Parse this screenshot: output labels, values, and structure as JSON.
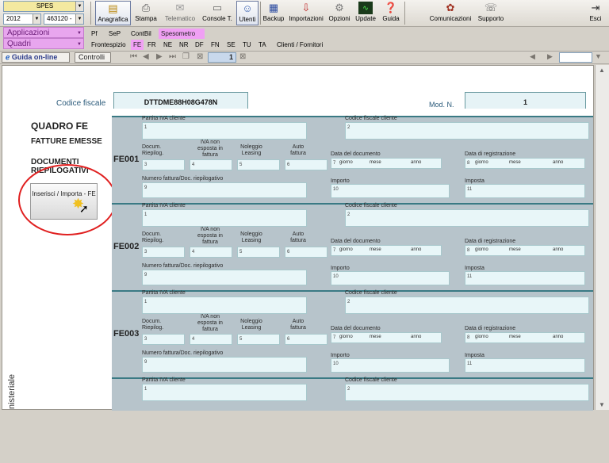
{
  "toolbar": {
    "top_select": "SPES",
    "year": "2012",
    "code": "463120 -",
    "buttons": [
      {
        "label": "Anagrafica",
        "icon": "address-book-icon"
      },
      {
        "label": "Stampa",
        "icon": "printer-icon"
      },
      {
        "label": "Telematico",
        "icon": "telematic-icon"
      },
      {
        "label": "Console T.",
        "icon": "console-icon"
      },
      {
        "label": "Utenti",
        "icon": "users-icon"
      },
      {
        "label": "Backup",
        "icon": "backup-icon"
      },
      {
        "label": "Importazioni",
        "icon": "import-icon"
      },
      {
        "label": "Opzioni",
        "icon": "options-icon"
      },
      {
        "label": "Update",
        "icon": "update-icon"
      },
      {
        "label": "Guida",
        "icon": "help-icon"
      },
      {
        "label": "Comunicazioni",
        "icon": "communications-icon"
      },
      {
        "label": "Supporto",
        "icon": "support-icon"
      },
      {
        "label": "Esci",
        "icon": "exit-icon"
      }
    ]
  },
  "menu": {
    "applicazioni": "Applicazioni",
    "quadri": "Quadri",
    "row1_tabs": [
      "Pf",
      "SeP",
      "ContBil",
      "Spesometro"
    ],
    "row2_tabs": [
      "Frontespizio",
      "FE",
      "FR",
      "NE",
      "NR",
      "DF",
      "FN",
      "SE",
      "TU",
      "TA",
      "Clienti / Fornitori"
    ]
  },
  "nav": {
    "guida_online": "Guida on-line",
    "controlli": "Controlli",
    "page_number": "1"
  },
  "form": {
    "codice_fiscale_label": "Codice fiscale",
    "codice_fiscale_value": "DTTDME88H08G478N",
    "mod_label": "Mod. N.",
    "mod_value": "1",
    "quadro_title": "QUADRO FE",
    "subtitle1": "FATTURE EMESSE",
    "subtitle2": "DOCUMENTI RIEPILOGATIVI",
    "import_button": "Inserisci / Importa - FE",
    "side_text": "nisteriale",
    "field_labels": {
      "piva": "Partita IVA cliente",
      "cf": "Codice fiscale cliente",
      "doc_riep": "Docum. Riepilog.",
      "iva_non_esposta": "IVA non esposta in fattura",
      "noleggio": "Noleggio Leasing",
      "autofattura": "Auto fattura",
      "data_documento": "Data del documento",
      "data_registrazione": "Data di registrazione",
      "numero_fattura": "Numero fattura/Doc. riepilogativo",
      "importo": "Importo",
      "imposta": "Imposta",
      "giorno": "giorno",
      "mese": "mese",
      "anno": "anno"
    },
    "rows": [
      "FE001",
      "FE002",
      "FE003"
    ]
  }
}
